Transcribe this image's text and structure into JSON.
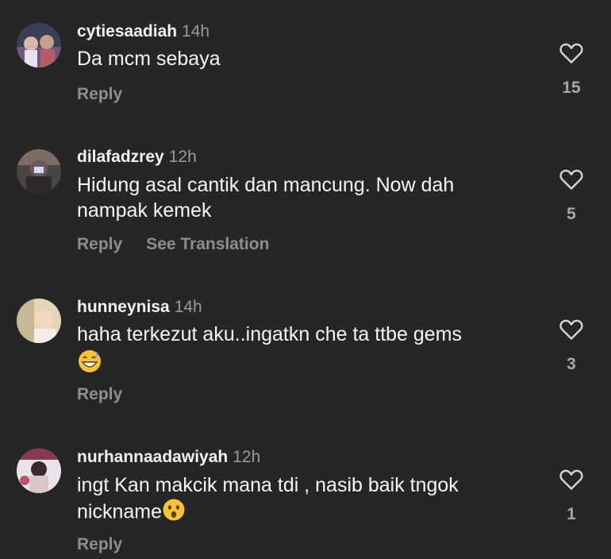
{
  "comments": [
    {
      "username": "cytiesaadiah",
      "time": "14h",
      "text": "Da mcm sebaya",
      "emoji": "",
      "actions": [
        "Reply"
      ],
      "likes": "15",
      "avatar_icon": "profile-photo"
    },
    {
      "username": "dilafadzrey",
      "time": "12h",
      "text": "Hidung asal cantik dan mancung. Now dah nampak kemek",
      "emoji": "",
      "actions": [
        "Reply",
        "See Translation"
      ],
      "likes": "5",
      "avatar_icon": "profile-photo"
    },
    {
      "username": "hunneynisa",
      "time": "14h",
      "text": "haha terkezut aku..ingatkn che ta ttbe gems",
      "emoji": "grinning-sweat-emoji",
      "actions": [
        "Reply"
      ],
      "likes": "3",
      "avatar_icon": "profile-photo"
    },
    {
      "username": "nurhannaadawiyah",
      "time": "12h",
      "text": "ingt Kan makcik mana tdi , nasib baik tngok nickname",
      "emoji": "astonished-face-emoji",
      "actions": [
        "Reply"
      ],
      "likes": "1",
      "avatar_icon": "profile-photo"
    }
  ],
  "icons": {
    "like": "heart-outline-icon"
  },
  "colors": {
    "background": "#262626",
    "muted_text": "#8e8e8e",
    "primary_text": "#f5f5f5"
  }
}
